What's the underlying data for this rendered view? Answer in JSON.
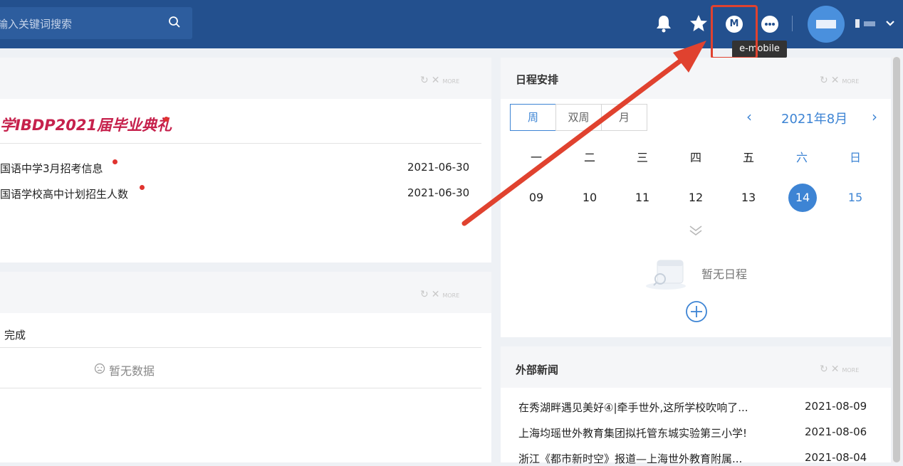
{
  "header": {
    "search_placeholder": "输入关键词搜索",
    "tooltip": "e-mobile",
    "emobile_letter": "M"
  },
  "panel1": {
    "featured_title": "学IBDP2021届毕业典礼",
    "rows": [
      {
        "text": "国语中学3月招考信息",
        "date": "2021-06-30"
      },
      {
        "text": "国语学校高中计划招生人数",
        "date": "2021-06-30"
      }
    ]
  },
  "panel2": {
    "tab_label": "完成",
    "empty": "暂无数据"
  },
  "schedule": {
    "title": "日程安排",
    "views": [
      "周",
      "双周",
      "月"
    ],
    "month": "2021年8月",
    "weekdays": [
      "一",
      "二",
      "三",
      "四",
      "五",
      "六",
      "日"
    ],
    "days": [
      "09",
      "10",
      "11",
      "12",
      "13",
      "14",
      "15"
    ],
    "today": "14",
    "empty": "暂无日程"
  },
  "news": {
    "title": "外部新闻",
    "items": [
      {
        "text": "在秀湖畔遇见美好④|牵手世外,这所学校吹响了...",
        "date": "2021-08-09"
      },
      {
        "text": "上海均瑶世外教育集团拟托管东城实验第三小学!",
        "date": "2021-08-06"
      },
      {
        "text": "浙江《都市新时空》报道—上海世外教育附属...",
        "date": "2021-08-04"
      }
    ]
  },
  "tools": {
    "more": "MORE"
  },
  "colors": {
    "header": "#23508e",
    "accent": "#3d84d4",
    "annotation": "#e0422f",
    "featured": "#c6214c"
  }
}
